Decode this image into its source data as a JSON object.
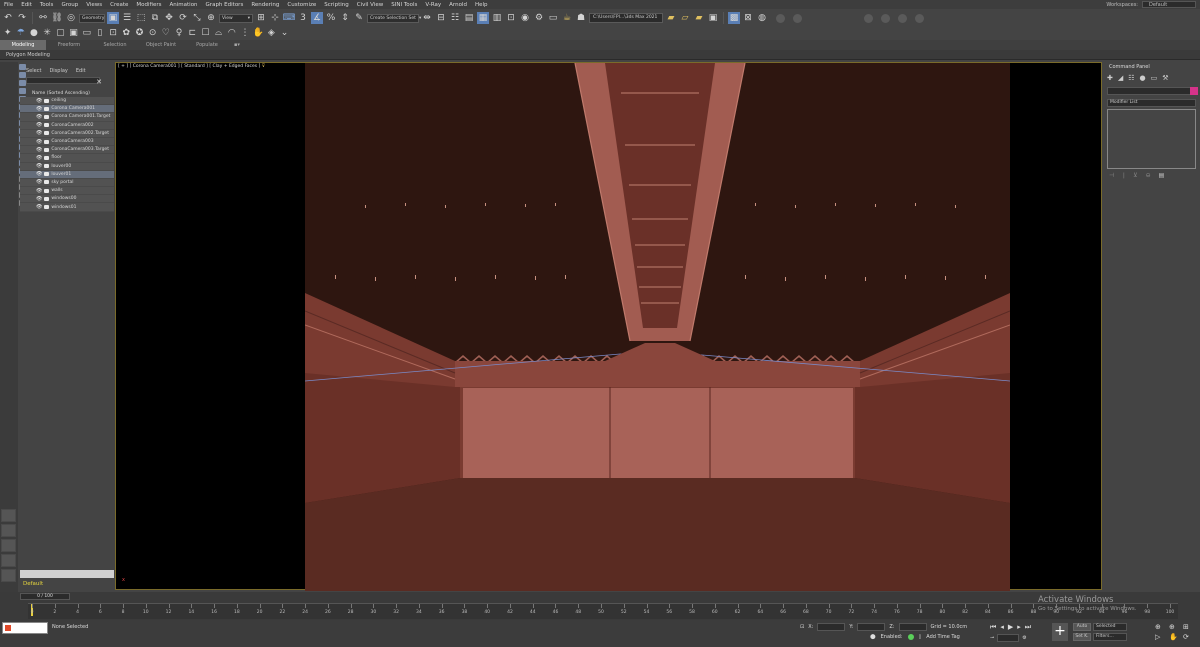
{
  "menu": [
    "File",
    "Edit",
    "Tools",
    "Group",
    "Views",
    "Create",
    "Modifiers",
    "Animation",
    "Graph Editors",
    "Rendering",
    "Customize",
    "Scripting",
    "Civil View",
    "SINI Tools",
    "V-Ray",
    "Arnold",
    "Help"
  ],
  "workspace": {
    "label": "Workspaces:",
    "value": "Default"
  },
  "toolbar": {
    "filter_dropdown": "Geometry",
    "refcoord_dropdown": "View",
    "selection_set": "Create Selection Set",
    "project_path": "C:\\Users\\FPI...\\3ds Max 2021"
  },
  "ribbon": {
    "tabs": [
      "Modeling",
      "Freeform",
      "Selection",
      "Object Paint",
      "Populate"
    ],
    "active": "Modeling",
    "sub": "Polygon Modeling"
  },
  "explorer": {
    "tabs": [
      "Select",
      "Display",
      "Edit"
    ],
    "header": "Name (Sorted Ascending)",
    "items": [
      {
        "name": "ceiling",
        "sel": false
      },
      {
        "name": "Corona Camera001",
        "sel": true
      },
      {
        "name": "Corona Camera001.Target",
        "sel": false
      },
      {
        "name": "CoronaCamera002",
        "sel": false
      },
      {
        "name": "CoronaCamera002.Target",
        "sel": false
      },
      {
        "name": "CoronaCamera003",
        "sel": false
      },
      {
        "name": "CoronaCamera003.Target",
        "sel": false
      },
      {
        "name": "floor",
        "sel": false
      },
      {
        "name": "louver00",
        "sel": false
      },
      {
        "name": "louver01",
        "sel": true
      },
      {
        "name": "sky portal",
        "sel": false
      },
      {
        "name": "walls",
        "sel": false
      },
      {
        "name": "windows00",
        "sel": false
      },
      {
        "name": "windows01",
        "sel": false
      }
    ],
    "layer": "Default"
  },
  "viewport": {
    "label": "[ + ] [ Corona Camera001 ] [ Standard ] [ Clay + Edged Faces ]",
    "axis": "x"
  },
  "command_panel": {
    "title": "Command Panel",
    "modifier_list": "Modifier List",
    "swatch_color": "#d6338a"
  },
  "timeline": {
    "frame_display": "0 / 100",
    "ticks": [
      0,
      2,
      4,
      6,
      8,
      10,
      12,
      14,
      16,
      18,
      20,
      22,
      24,
      26,
      28,
      30,
      32,
      34,
      36,
      38,
      40,
      42,
      44,
      46,
      48,
      50,
      52,
      54,
      56,
      58,
      60,
      62,
      64,
      66,
      68,
      70,
      72,
      74,
      76,
      78,
      80,
      82,
      84,
      86,
      88,
      90,
      92,
      94,
      96,
      98,
      100
    ]
  },
  "status": {
    "selection": "None Selected",
    "x_label": "X:",
    "y_label": "Y:",
    "z_label": "Z:",
    "grid": "Grid = 10.0cm",
    "enabled": "Enabled:",
    "add_time_tag": "Add Time Tag",
    "auto": "Auto",
    "set_k": "Set K.",
    "selected": "Selected",
    "filters": "Filters..."
  },
  "watermark": {
    "title": "Activate Windows",
    "sub": "Go to Settings to activate Windows."
  }
}
